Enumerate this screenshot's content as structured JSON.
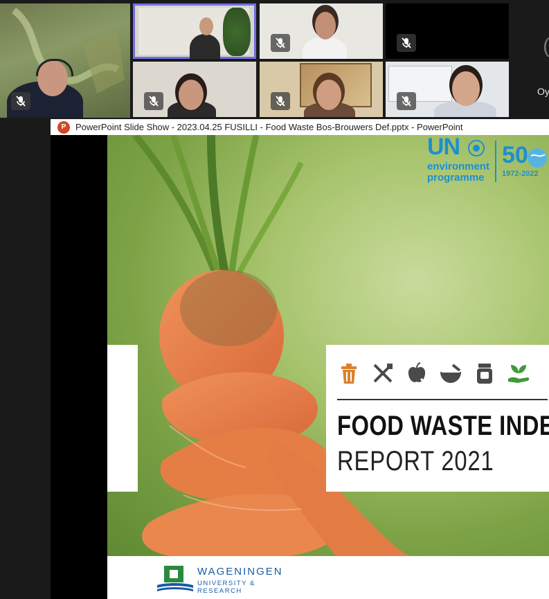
{
  "meeting": {
    "participants": [
      {
        "id": "p1",
        "muted": true
      },
      {
        "id": "p2",
        "muted": false,
        "active": true
      },
      {
        "id": "p3",
        "muted": true
      },
      {
        "id": "p4",
        "muted": true
      },
      {
        "id": "p5",
        "muted": true
      },
      {
        "id": "p6",
        "muted": true
      },
      {
        "id": "p7",
        "muted": true
      }
    ],
    "side_name": "Oy"
  },
  "powerpoint": {
    "logo_letter": "P",
    "window_title": "PowerPoint Slide Show  -  2023.04.25 FUSILLI - Food Waste Bos-Brouwers Def.pptx - PowerPoint"
  },
  "slide": {
    "un_logo": {
      "un": "UN",
      "line1": "environment",
      "line2": "programme",
      "fifty": "50",
      "years": "1972-2022"
    },
    "card": {
      "icons": [
        "trash-bin-icon",
        "fork-knife-icon",
        "apple-icon",
        "bowl-icon",
        "jar-icon",
        "plant-hand-icon"
      ],
      "title_line1": "FOOD WASTE INDEX",
      "title_line2": "REPORT 2021"
    },
    "wur": {
      "name": "WAGENINGEN",
      "sub": "UNIVERSITY & RESEARCH"
    }
  },
  "colors": {
    "active_border": "#6f6fe6",
    "un_blue": "#1d8fcf",
    "icon_orange": "#d9822b",
    "icon_grey": "#4a4a4a",
    "icon_green": "#3f9a3a",
    "wur_blue": "#1a5aa6",
    "wur_green": "#2a8a3e"
  }
}
